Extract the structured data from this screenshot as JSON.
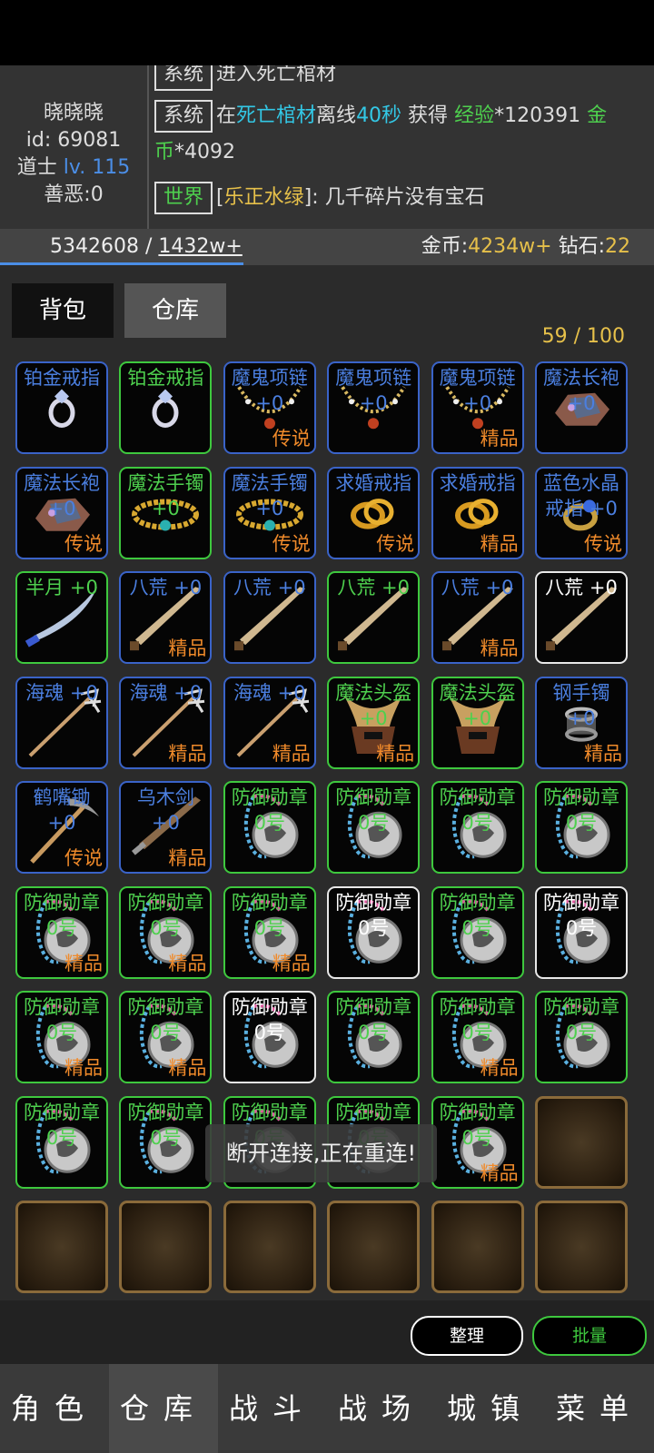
{
  "player": {
    "name": "晓晓晓",
    "id": "id: 69081",
    "class": "道士",
    "level": "lv. 115",
    "karma": "善恶:0"
  },
  "chat": [
    {
      "tag": "系统",
      "text": "进入死亡棺材"
    },
    {
      "tag": "系统",
      "p1": "在",
      "loc": "死亡棺材",
      "p2": "离线",
      "dur": "40秒",
      "p3": " 获得 ",
      "exp_label": "经验",
      "exp_val": "*120391",
      "gold_label1": "金",
      "gold_label2": "币",
      "gold_val": "*4092"
    },
    {
      "tag": "世界",
      "user": "乐正水绿",
      "msg": ": 几千碎片没有宝石"
    }
  ],
  "stats": {
    "exp": "5342608 / ",
    "exp_next": "1432w+",
    "gold_label": "金币:",
    "gold": "4234w+",
    "diamond_label": " 钻石:",
    "diamond": "22"
  },
  "tabs": {
    "bag": "背包",
    "warehouse": "仓库"
  },
  "capacity": "59 / 100",
  "items": [
    {
      "name": "铂金戒指",
      "grade": "",
      "border": "blue",
      "nc": "blue",
      "icon": "ring-icon"
    },
    {
      "name": "铂金戒指",
      "grade": "",
      "border": "green",
      "nc": "green",
      "icon": "ring-icon"
    },
    {
      "name": "魔鬼项链",
      "plus": "+0",
      "grade": "传说",
      "border": "blue",
      "nc": "blue",
      "icon": "necklace-icon"
    },
    {
      "name": "魔鬼项链",
      "plus": "+0",
      "grade": "",
      "border": "blue",
      "nc": "blue",
      "icon": "necklace-icon"
    },
    {
      "name": "魔鬼项链",
      "plus": "+0",
      "grade": "精品",
      "border": "blue",
      "nc": "blue",
      "icon": "necklace-icon"
    },
    {
      "name": "魔法长袍",
      "plus": "+0",
      "grade": "",
      "border": "blue",
      "nc": "blue",
      "icon": "robe-icon"
    },
    {
      "name": "魔法长袍",
      "plus": "+0",
      "grade": "传说",
      "border": "blue",
      "nc": "blue",
      "icon": "robe-icon"
    },
    {
      "name": "魔法手镯",
      "plus": "+0",
      "grade": "",
      "border": "green",
      "nc": "green",
      "icon": "bracelet-icon"
    },
    {
      "name": "魔法手镯",
      "plus": "+0",
      "grade": "传说",
      "border": "blue",
      "nc": "blue",
      "icon": "bracelet-icon"
    },
    {
      "name": "求婚戒指",
      "plus": "",
      "grade": "传说",
      "border": "blue",
      "nc": "blue",
      "icon": "gold-ring-icon"
    },
    {
      "name": "求婚戒指",
      "plus": "",
      "grade": "精品",
      "border": "blue",
      "nc": "blue",
      "icon": "gold-ring-icon"
    },
    {
      "name": "蓝色水晶戒指 +0",
      "grade": "传说",
      "border": "blue",
      "nc": "blue",
      "icon": "crystal-ring-icon",
      "wrap": true
    },
    {
      "name": "半月 +0",
      "grade": "",
      "border": "green",
      "nc": "green",
      "icon": "saber-icon"
    },
    {
      "name": "八荒 +0",
      "grade": "精品",
      "border": "blue",
      "nc": "blue",
      "icon": "sword-icon"
    },
    {
      "name": "八荒 +0",
      "grade": "",
      "border": "blue",
      "nc": "blue",
      "icon": "sword-icon"
    },
    {
      "name": "八荒 +0",
      "grade": "",
      "border": "green",
      "nc": "green",
      "icon": "sword-icon"
    },
    {
      "name": "八荒 +0",
      "grade": "精品",
      "border": "blue",
      "nc": "blue",
      "icon": "sword-icon"
    },
    {
      "name": "八荒 +0",
      "grade": "",
      "border": "white",
      "nc": "white",
      "icon": "sword-icon"
    },
    {
      "name": "海魂 +0",
      "grade": "",
      "border": "blue",
      "nc": "blue",
      "icon": "trident-icon"
    },
    {
      "name": "海魂 +0",
      "grade": "精品",
      "border": "blue",
      "nc": "blue",
      "icon": "trident-icon"
    },
    {
      "name": "海魂 +0",
      "grade": "精品",
      "border": "blue",
      "nc": "blue",
      "icon": "trident-icon"
    },
    {
      "name": "魔法头盔",
      "plus": "+0",
      "grade": "精品",
      "border": "green",
      "nc": "green",
      "icon": "helmet-icon"
    },
    {
      "name": "魔法头盔",
      "plus": "+0",
      "grade": "",
      "border": "green",
      "nc": "green",
      "icon": "helmet-icon"
    },
    {
      "name": "钢手镯",
      "plus": "+0",
      "grade": "精品",
      "border": "blue",
      "nc": "blue",
      "icon": "steel-bracelet-icon"
    },
    {
      "name": "鹤嘴锄",
      "plus": "+0",
      "grade": "传说",
      "border": "blue",
      "nc": "blue",
      "icon": "pickaxe-icon"
    },
    {
      "name": "乌木剑",
      "plus": "+0",
      "grade": "精品",
      "border": "blue",
      "nc": "blue",
      "icon": "wooden-sword-icon"
    },
    {
      "name": "防御勋章",
      "plus": "0号",
      "grade": "",
      "border": "green",
      "nc": "green",
      "icon": "medal-icon"
    },
    {
      "name": "防御勋章",
      "plus": "0号",
      "grade": "",
      "border": "green",
      "nc": "green",
      "icon": "medal-icon"
    },
    {
      "name": "防御勋章",
      "plus": "0号",
      "grade": "",
      "border": "green",
      "nc": "green",
      "icon": "medal-icon"
    },
    {
      "name": "防御勋章",
      "plus": "0号",
      "grade": "",
      "border": "green",
      "nc": "green",
      "icon": "medal-icon"
    },
    {
      "name": "防御勋章",
      "plus": "0号",
      "grade": "精品",
      "border": "green",
      "nc": "green",
      "icon": "medal-icon"
    },
    {
      "name": "防御勋章",
      "plus": "0号",
      "grade": "精品",
      "border": "green",
      "nc": "green",
      "icon": "medal-icon"
    },
    {
      "name": "防御勋章",
      "plus": "0号",
      "grade": "精品",
      "border": "green",
      "nc": "green",
      "icon": "medal-icon"
    },
    {
      "name": "防御勋章",
      "plus": "0号",
      "grade": "",
      "border": "white",
      "nc": "white",
      "icon": "medal-icon"
    },
    {
      "name": "防御勋章",
      "plus": "0号",
      "grade": "",
      "border": "green",
      "nc": "green",
      "icon": "medal-icon"
    },
    {
      "name": "防御勋章",
      "plus": "0号",
      "grade": "",
      "border": "white",
      "nc": "white",
      "icon": "medal-icon"
    },
    {
      "name": "防御勋章",
      "plus": "0号",
      "grade": "精品",
      "border": "green",
      "nc": "green",
      "icon": "medal-icon"
    },
    {
      "name": "防御勋章",
      "plus": "0号",
      "grade": "精品",
      "border": "green",
      "nc": "green",
      "icon": "medal-icon"
    },
    {
      "name": "防御勋章",
      "plus": "0号",
      "grade": "",
      "border": "white",
      "nc": "white",
      "icon": "medal-icon"
    },
    {
      "name": "防御勋章",
      "plus": "0号",
      "grade": "",
      "border": "green",
      "nc": "green",
      "icon": "medal-icon"
    },
    {
      "name": "防御勋章",
      "plus": "0号",
      "grade": "精品",
      "border": "green",
      "nc": "green",
      "icon": "medal-icon"
    },
    {
      "name": "防御勋章",
      "plus": "0号",
      "grade": "",
      "border": "green",
      "nc": "green",
      "icon": "medal-icon"
    },
    {
      "name": "防御勋章",
      "plus": "0号",
      "grade": "",
      "border": "green",
      "nc": "green",
      "icon": "medal-icon"
    },
    {
      "name": "防御勋章",
      "plus": "0号",
      "grade": "",
      "border": "green",
      "nc": "green",
      "icon": "medal-icon"
    },
    {
      "name": "防御勋章",
      "plus": "0号",
      "grade": "",
      "border": "green",
      "nc": "green",
      "icon": "medal-icon"
    },
    {
      "name": "防御勋章",
      "plus": "0号",
      "grade": "",
      "border": "green",
      "nc": "green",
      "icon": "medal-icon"
    },
    {
      "name": "防御勋章",
      "plus": "0号",
      "grade": "精品",
      "border": "green",
      "nc": "green",
      "icon": "medal-icon"
    },
    {
      "empty": true
    },
    {
      "empty": true
    },
    {
      "empty": true
    },
    {
      "empty": true
    },
    {
      "empty": true
    },
    {
      "empty": true
    },
    {
      "empty": true
    }
  ],
  "toast": "断开连接,正在重连!",
  "buttons": {
    "sort": "整理",
    "batch": "批量"
  },
  "nav": [
    "角色",
    "仓库",
    "战斗",
    "战场",
    "城镇",
    "菜单"
  ],
  "colors": {
    "blue": "#4b7fe0",
    "green": "#4ed04e",
    "white": "#ffffff",
    "grade": "#f08a2a",
    "gold": "#e6c04a"
  }
}
